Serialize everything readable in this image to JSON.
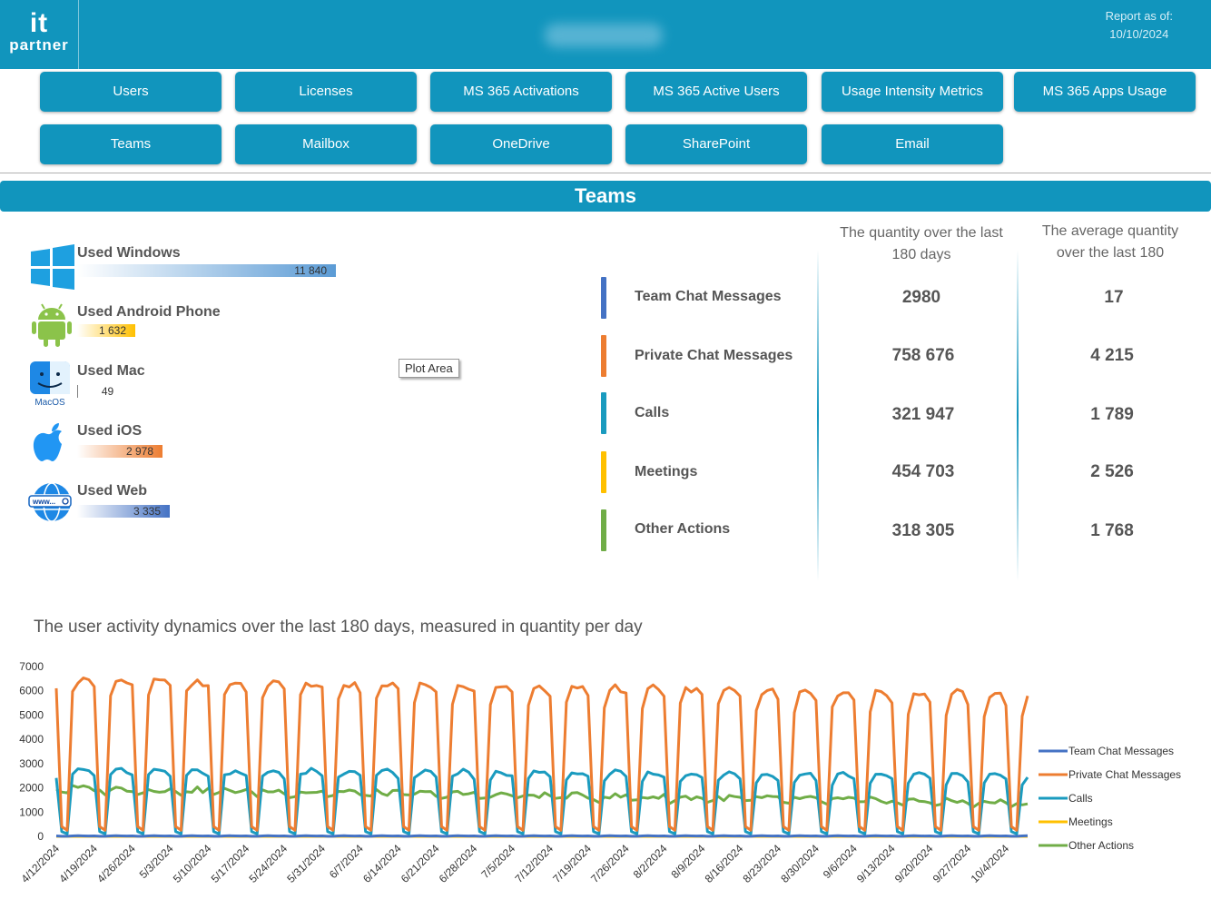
{
  "header": {
    "logo_line1": "it",
    "logo_line2": "partner",
    "report_label": "Report as of:",
    "report_date": "10/10/2024"
  },
  "nav": {
    "row1": [
      "Users",
      "Licenses",
      "MS 365 Activations",
      "MS 365 Active Users",
      "Usage Intensity Metrics",
      "MS 365 Apps Usage"
    ],
    "row2": [
      "Teams",
      "Mailbox",
      "OneDrive",
      "SharePoint",
      "Email"
    ]
  },
  "section_title": "Teams",
  "devices": [
    {
      "label": "Used Windows",
      "value": "11 840",
      "icon": "windows-icon",
      "color": "#5b9bd5"
    },
    {
      "label": "Used Android Phone",
      "value": "1 632",
      "icon": "android-icon",
      "color": "#ffc000"
    },
    {
      "label": "Used Mac",
      "value": "49",
      "icon": "macos-icon",
      "icon_caption": "MacOS",
      "color": "#7f7f7f"
    },
    {
      "label": "Used iOS",
      "value": "2 978",
      "icon": "apple-icon",
      "color": "#ed7d31"
    },
    {
      "label": "Used Web",
      "value": "3 335",
      "icon": "web-icon",
      "color": "#4472c4"
    }
  ],
  "tooltip": "Plot Area",
  "metrics": {
    "col1_header": "The quantity over the last 180 days",
    "col2_header": "The average quantity over the last 180",
    "rows": [
      {
        "label": "Team Chat Messages",
        "total": "2980",
        "avg": "17",
        "color": "#4472c4"
      },
      {
        "label": "Private Chat Messages",
        "total": "758 676",
        "avg": "4 215",
        "color": "#ed7d31"
      },
      {
        "label": "Calls",
        "total": "321 947",
        "avg": "1 789",
        "color": "#1a9bbf"
      },
      {
        "label": "Meetings",
        "total": "454 703",
        "avg": "2 526",
        "color": "#ffc000"
      },
      {
        "label": "Other Actions",
        "total": "318 305",
        "avg": "1 768",
        "color": "#70ad47"
      }
    ]
  },
  "chart_data": {
    "type": "line",
    "title": "The user activity dynamics over the last 180 days, measured in quantity per day",
    "ylim": [
      0,
      7000
    ],
    "yticks": [
      0,
      1000,
      2000,
      3000,
      4000,
      5000,
      6000,
      7000
    ],
    "x_start": "4/12/2024",
    "days": 180,
    "x_tick_labels": [
      "4/12/2024",
      "4/19/2024",
      "4/26/2024",
      "5/3/2024",
      "5/10/2024",
      "5/17/2024",
      "5/24/2024",
      "5/31/2024",
      "6/7/2024",
      "6/14/2024",
      "6/21/2024",
      "6/28/2024",
      "7/5/2024",
      "7/12/2024",
      "7/19/2024",
      "7/26/2024",
      "8/2/2024",
      "8/9/2024",
      "8/16/2024",
      "8/23/2024",
      "8/30/2024",
      "9/6/2024",
      "9/13/2024",
      "9/20/2024",
      "9/27/2024",
      "10/4/2024"
    ],
    "legend_position": "right",
    "series": [
      {
        "name": "Team Chat Messages",
        "color": "#4472c4",
        "weekday": [
          20,
          25,
          20,
          15,
          20
        ],
        "weekend": [
          5,
          5
        ]
      },
      {
        "name": "Private Chat Messages",
        "color": "#ed7d31",
        "weekday_start": [
          6000,
          6400,
          6450,
          6400,
          6200
        ],
        "weekday_end": [
          5000,
          5800,
          5900,
          5800,
          5500
        ],
        "weekend": [
          400,
          250
        ]
      },
      {
        "name": "Calls",
        "color": "#1a9bbf",
        "weekday_start": [
          2600,
          2700,
          2750,
          2700,
          2500
        ],
        "weekday_end": [
          2100,
          2500,
          2600,
          2500,
          2300
        ],
        "weekend": [
          200,
          100
        ]
      },
      {
        "name": "Meetings",
        "color": "#ffc000",
        "weekday": [
          0,
          0,
          0,
          0,
          0
        ],
        "weekend": [
          0,
          0
        ]
      },
      {
        "name": "Other Actions",
        "color": "#70ad47",
        "start_level": 2000,
        "end_level": 1400
      }
    ]
  }
}
